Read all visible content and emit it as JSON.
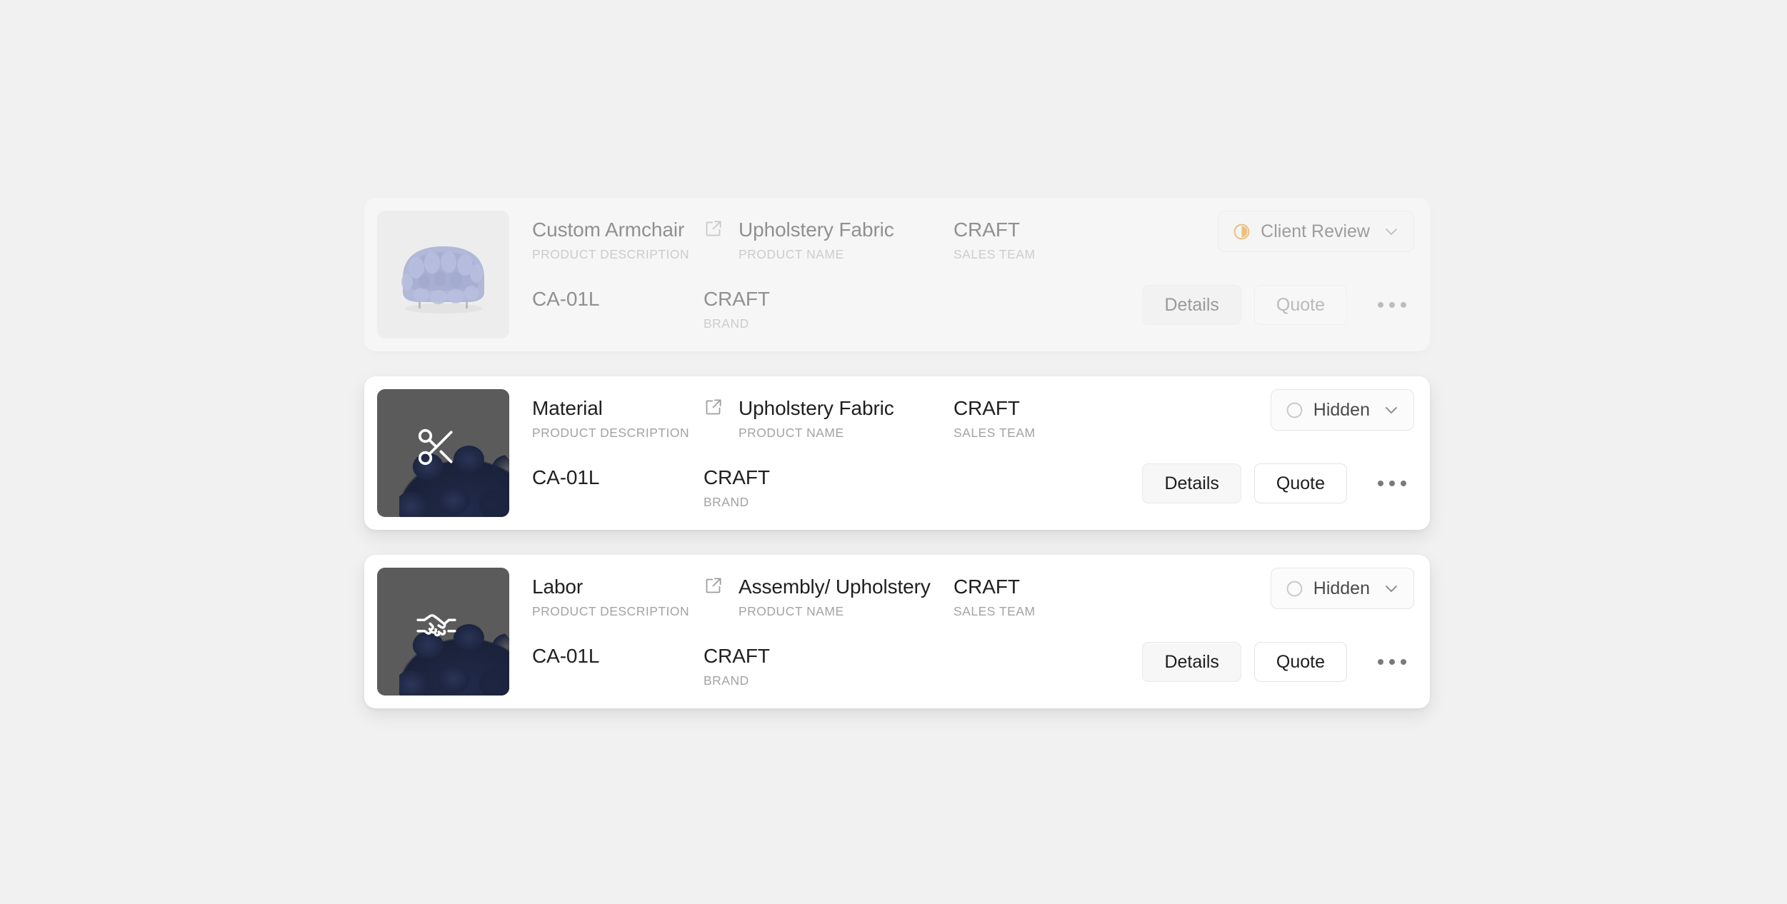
{
  "background_color": "#f1f1f1",
  "labels": {
    "product_description": "PRODUCT DESCRIPTION",
    "product_name": "PRODUCT NAME",
    "sales_team": "SALES TEAM",
    "brand": "BRAND"
  },
  "actions": {
    "details_label": "Details",
    "quote_label": "Quote",
    "more_label": "More options"
  },
  "status_colors": {
    "client_review": "#e8a33d",
    "hidden": "#c9c9c9"
  },
  "cards": [
    {
      "id": "custom-armchair",
      "dimmed": true,
      "thumbnail": {
        "style": "light",
        "icon": "armchair-illustration",
        "background": "#ebebeb"
      },
      "description": "Custom Armchair",
      "sku": "CA-01L",
      "product_name": "Upholstery Fabric",
      "brand": "CRAFT",
      "sales_team": "CRAFT",
      "status": {
        "label": "Client Review",
        "icon": "half-filled-circle-icon",
        "color": "#e8a33d"
      }
    },
    {
      "id": "material",
      "dimmed": false,
      "thumbnail": {
        "style": "dark",
        "icon": "scissors-icon",
        "background": "#5b5b5b"
      },
      "description": "Material",
      "sku": "CA-01L",
      "product_name": "Upholstery Fabric",
      "brand": "CRAFT",
      "sales_team": "CRAFT",
      "status": {
        "label": "Hidden",
        "icon": "empty-circle-icon",
        "color": "#c9c9c9"
      }
    },
    {
      "id": "labor",
      "dimmed": false,
      "thumbnail": {
        "style": "dark",
        "icon": "handshake-icon",
        "background": "#5b5b5b"
      },
      "description": "Labor",
      "sku": "CA-01L",
      "product_name": "Assembly/ Upholstery",
      "brand": "CRAFT",
      "sales_team": "CRAFT",
      "status": {
        "label": "Hidden",
        "icon": "empty-circle-icon",
        "color": "#c9c9c9"
      }
    }
  ]
}
